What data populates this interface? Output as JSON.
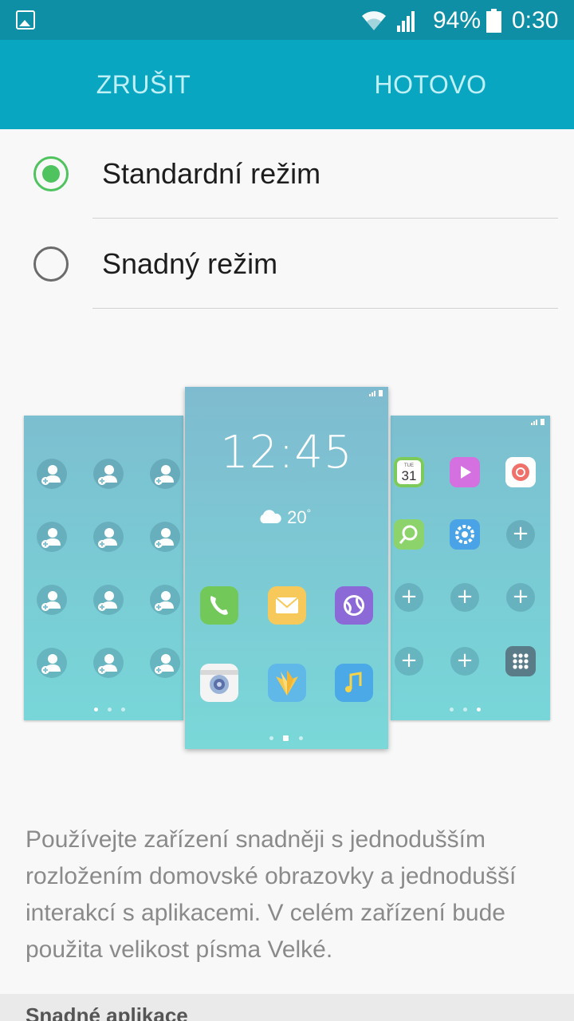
{
  "status_bar": {
    "battery_percent": "94%",
    "time": "0:30",
    "icons": [
      "image-notification-icon",
      "wifi-icon",
      "signal-icon",
      "battery-icon"
    ]
  },
  "action_bar": {
    "cancel_label": "ZRUŠIT",
    "done_label": "HOTOVO"
  },
  "options": [
    {
      "label": "Standardní režim",
      "selected": true
    },
    {
      "label": "Snadný režim",
      "selected": false
    }
  ],
  "illustration": {
    "clock": "12:45",
    "temperature": "20",
    "calendar_day": "TUE",
    "calendar_date": "31"
  },
  "description": "Používejte zařízení snadněji s jednodušším rozložením domovské obrazovky a jednodušší interakcí s aplikacemi. V celém zařízení bude použita velikost písma Velké.",
  "section_header": "Snadné aplikace",
  "colors": {
    "status_bar": "#0e8fa5",
    "action_bar": "#09a6c1",
    "radio_checked": "#4fc35d",
    "action_text": "#bff0f6"
  }
}
